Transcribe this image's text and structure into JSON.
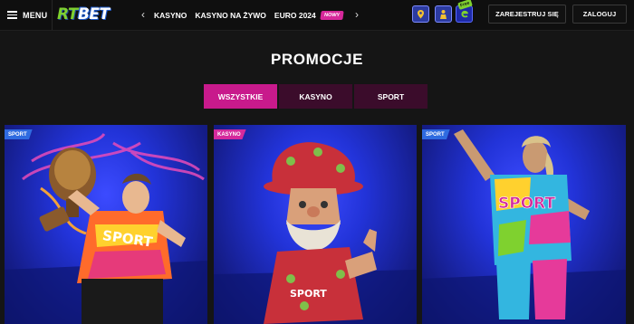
{
  "header": {
    "menu_label": "MENU",
    "logo": {
      "part1": "RT",
      "part2": "BET"
    },
    "nav_prev": "‹",
    "nav_next": "›",
    "nav_items": [
      "KASYNO",
      "KASYNO NA ŻYWO",
      "EURO 2024"
    ],
    "new_badge": "NOWY",
    "free_tag": "Free",
    "icons": [
      "map-pin-icon",
      "person-icon",
      "free-spins-icon"
    ],
    "register_label": "ZAREJESTRUJ SIĘ",
    "login_label": "ZALOGUJ"
  },
  "page": {
    "title": "PROMOCJE"
  },
  "tabs": [
    {
      "label": "WSZYSTKIE",
      "active": true
    },
    {
      "label": "KASYNO",
      "active": false
    },
    {
      "label": "SPORT",
      "active": false
    }
  ],
  "cards": [
    {
      "badge": "SPORT",
      "shirt_text": "SPORT"
    },
    {
      "badge": "KASYNO",
      "shirt_text": "SPORT"
    },
    {
      "badge": "SPORT",
      "shirt_text": "SPORT"
    }
  ],
  "colors": {
    "accent": "#c81a8c",
    "tab_inactive": "#3b0c2b",
    "sport_badge": "#2f6be0",
    "kasyno_badge": "#d42a9c",
    "logo_green": "#7fd12f",
    "card_blue": "#2233d8"
  }
}
